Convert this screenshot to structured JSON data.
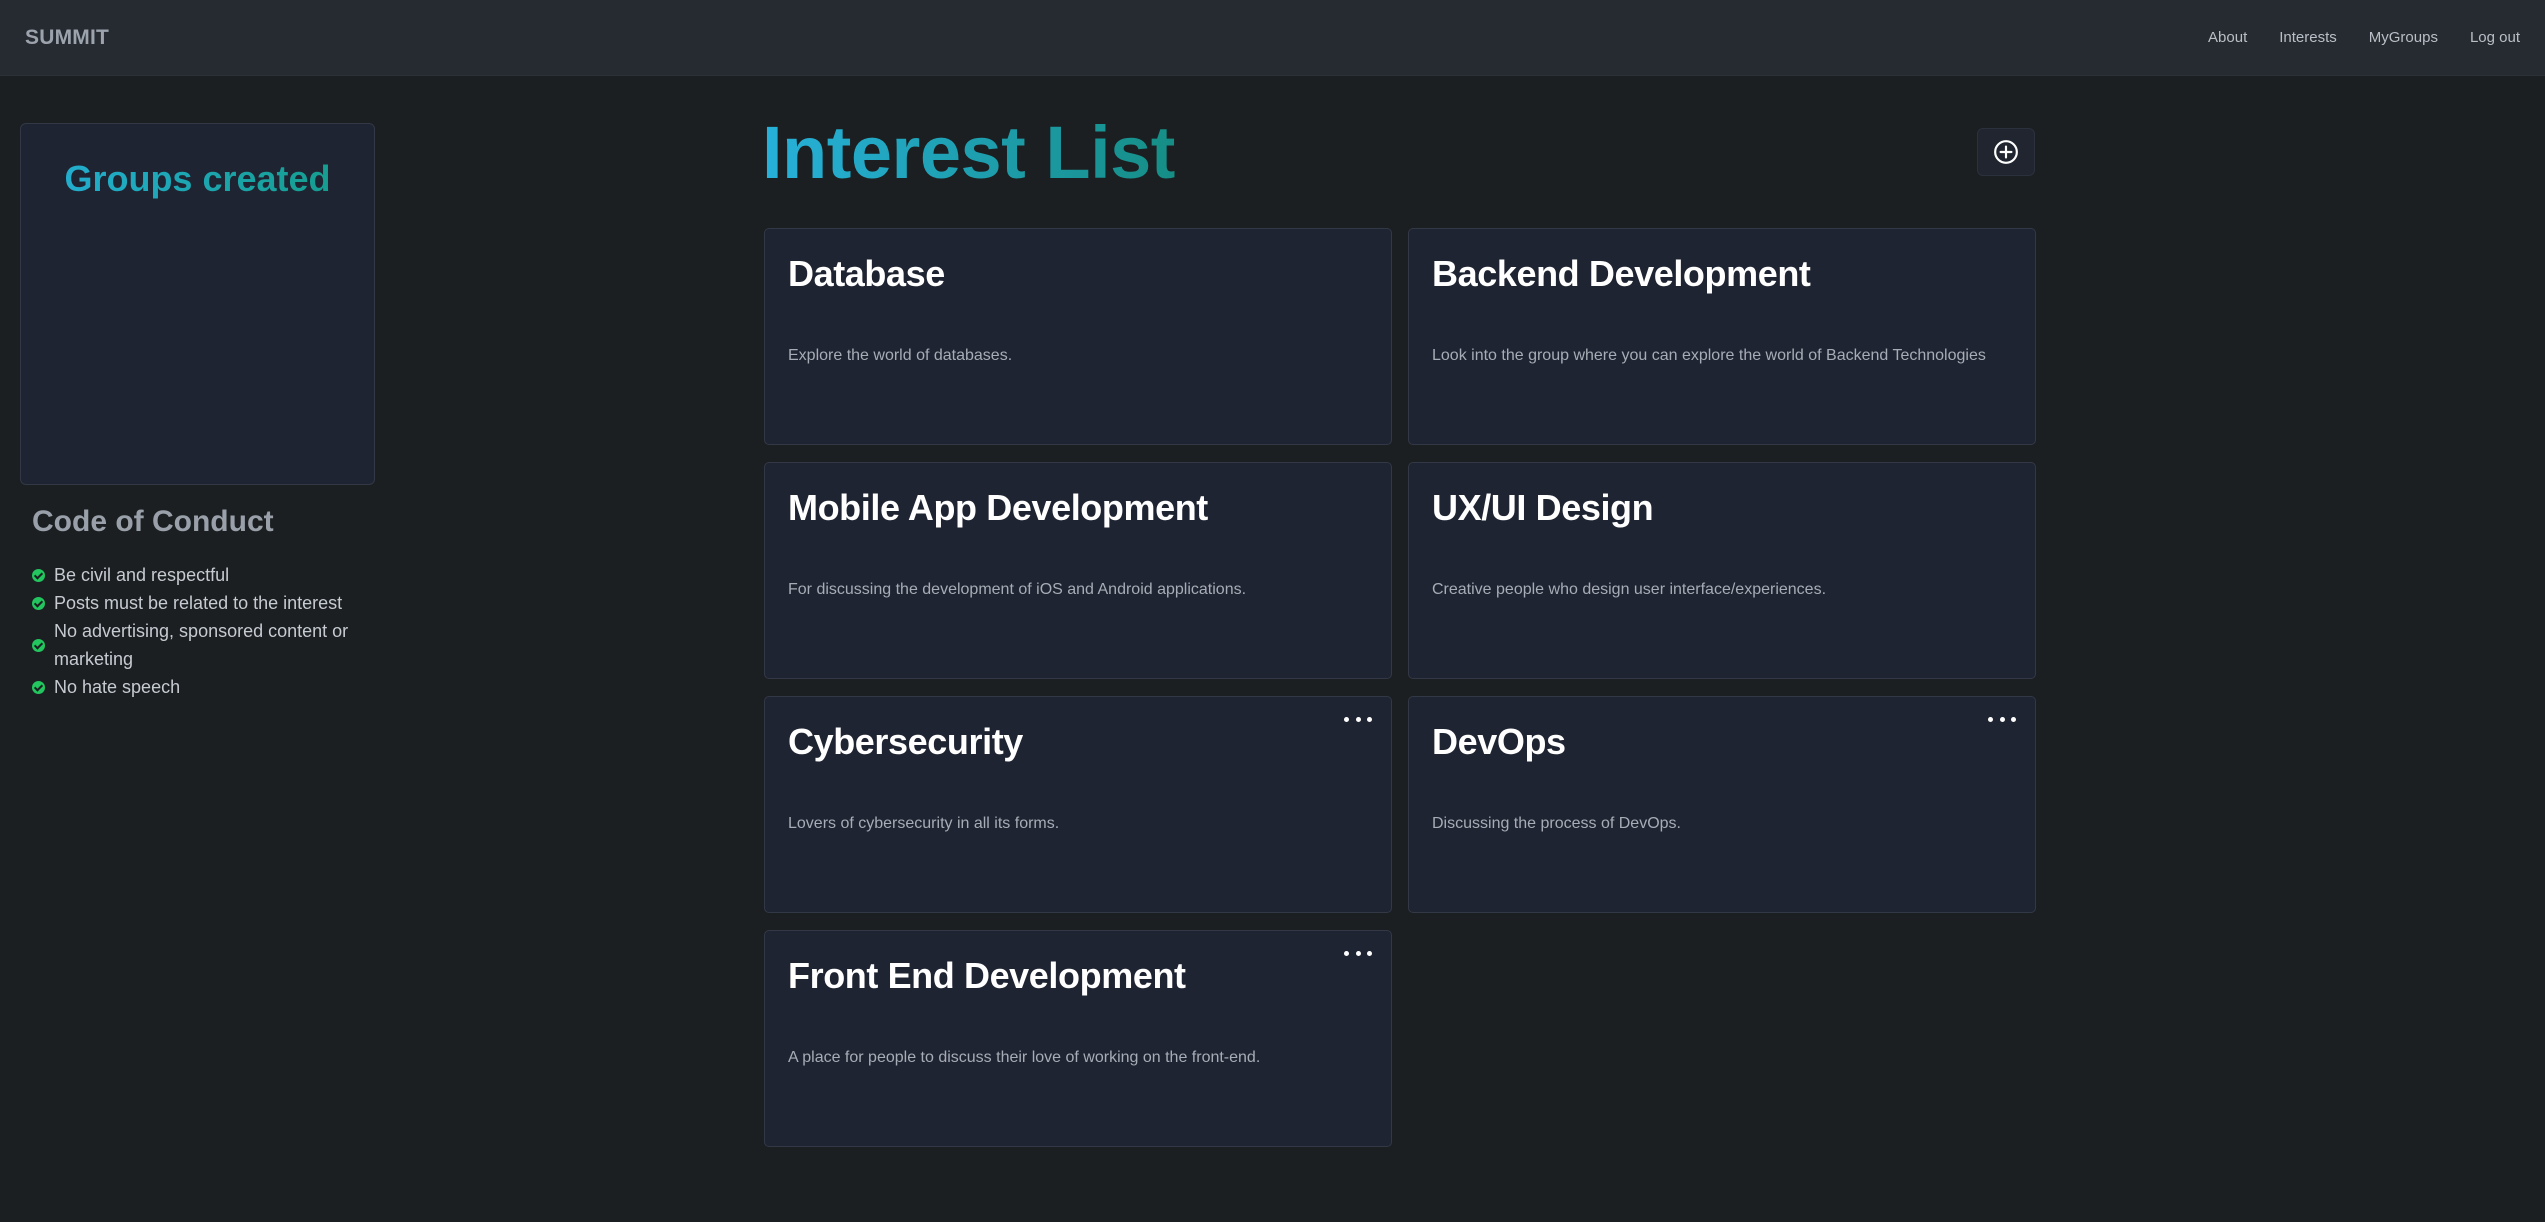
{
  "navbar": {
    "brand": "SUMMIT",
    "links": [
      "About",
      "Interests",
      "MyGroups",
      "Log out"
    ]
  },
  "sidebar": {
    "groups_title": "Groups created",
    "code_of_conduct": {
      "title": "Code of Conduct",
      "rules": [
        "Be civil and respectful",
        "Posts must be related to the interest",
        "No advertising, sponsored content or marketing",
        "No hate speech"
      ]
    }
  },
  "main": {
    "title": "Interest List",
    "add_icon": "plus-circle-icon",
    "interests": [
      {
        "title": "Database",
        "description": "Explore the world of databases.",
        "has_menu": false
      },
      {
        "title": "Backend Development",
        "description": "Look into the group where you can explore the world of Backend Technologies",
        "has_menu": false
      },
      {
        "title": "Mobile App Development",
        "description": "For discussing the development of iOS and Android applications.",
        "has_menu": false
      },
      {
        "title": "UX/UI Design",
        "description": "Creative people who design user interface/experiences.",
        "has_menu": false
      },
      {
        "title": "Cybersecurity",
        "description": "Lovers of cybersecurity in all its forms.",
        "has_menu": true
      },
      {
        "title": "DevOps",
        "description": "Discussing the process of DevOps.",
        "has_menu": true
      },
      {
        "title": "Front End Development",
        "description": "A place for people to discuss their love of working on the front-end.",
        "has_menu": true
      }
    ]
  },
  "colors": {
    "background": "#1b1f22",
    "navbar": "#262b31",
    "card": "#1f2432",
    "gradient_start": "#27b1da",
    "gradient_end": "#168e86",
    "check": "#22c55e"
  }
}
